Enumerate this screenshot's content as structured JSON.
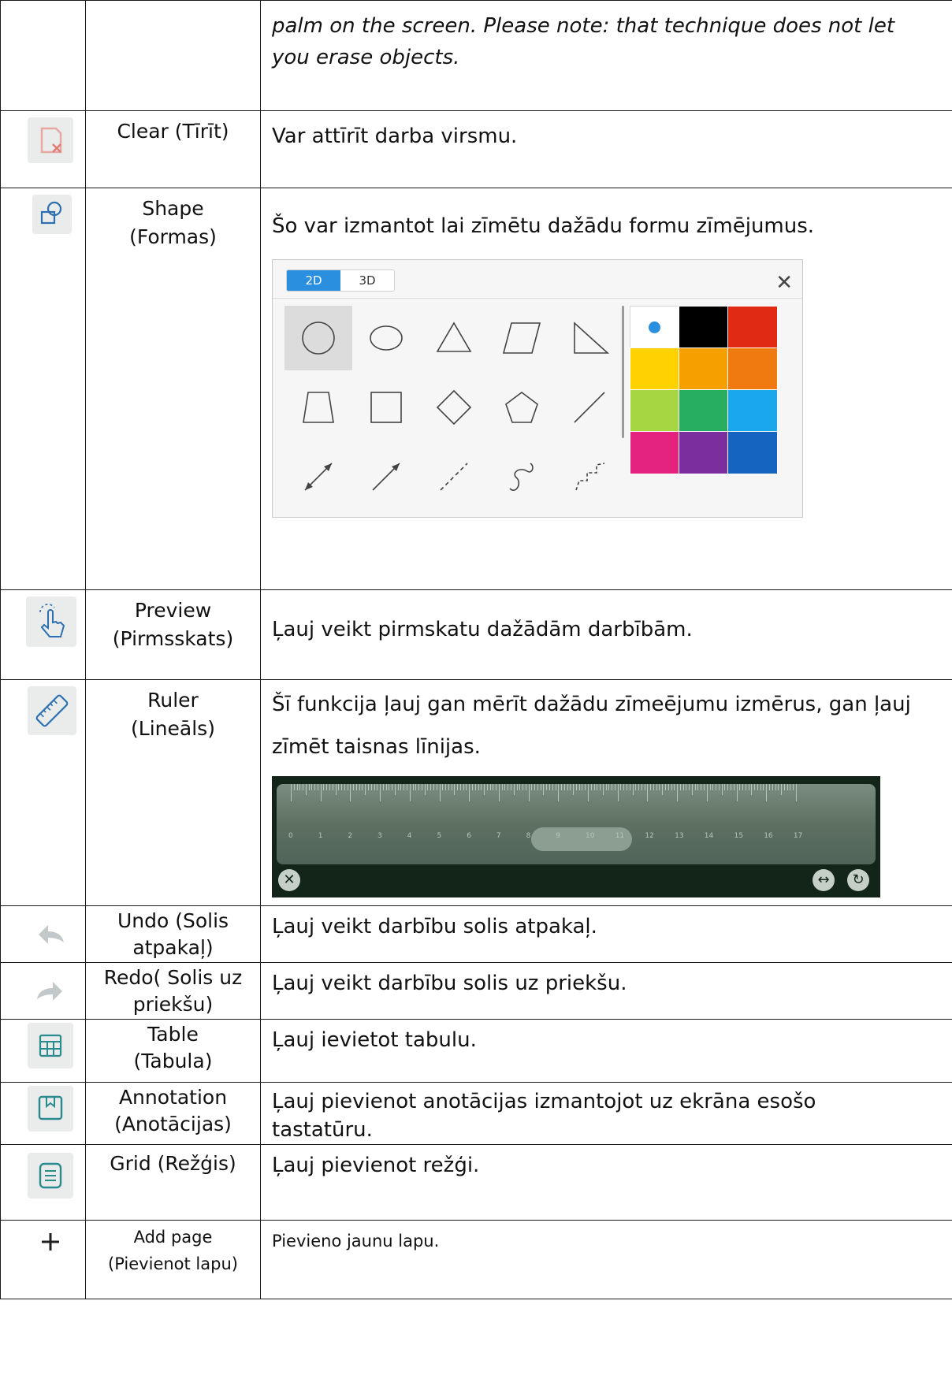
{
  "top_row": {
    "line1": "palm on the screen. Please note: that technique does not let",
    "line2": "you erase objects."
  },
  "rows": [
    {
      "name": "Clear (Tīrīt)",
      "desc": "Var attīrīt darba virsmu.",
      "icon": "clear-icon"
    },
    {
      "name": "Shape\n(Formas)",
      "desc": "Šo var izmantot lai zīmētu dažādu formu zīmējumus.",
      "icon": "shape-icon"
    },
    {
      "name": "Preview\n(Pirmsskats)",
      "desc": "Ļauj veikt pirmskatu dažādām darbībām.",
      "icon": "preview-hand-icon"
    },
    {
      "name": "Ruler\n(Lineāls)",
      "desc": "Šī funkcija ļauj gan mērīt dažādu zīmeējumu izmērus, gan ļauj\nzīmēt taisnas līnijas.",
      "icon": "ruler-icon"
    },
    {
      "name": "Undo (Solis\natpakaļ)",
      "desc": "Ļauj veikt darbību solis atpakaļ.",
      "icon": "undo-icon"
    },
    {
      "name": "Redo( Solis uz\npriekšu)",
      "desc": "Ļauj veikt darbību solis uz priekšu.",
      "icon": "redo-icon"
    },
    {
      "name": "Table\n(Tabula)",
      "desc": "Ļauj ievietot tabulu.",
      "icon": "table-icon"
    },
    {
      "name": "Annotation\n(Anotācijas)",
      "desc": "Ļauj pievienot anotācijas izmantojot uz ekrāna esošo\ntastatūru.",
      "icon": "annotation-icon"
    },
    {
      "name": "Grid (Režģis)",
      "desc": "Ļauj pievienot režģi.",
      "icon": "grid-icon"
    },
    {
      "name": "Add page\n(Pievienot lapu)",
      "desc": "Pievieno jaunu lapu.",
      "icon": "plus-icon"
    }
  ],
  "shape_panel": {
    "tabs": [
      "2D",
      "3D"
    ],
    "active_tab": "2D",
    "close": "✕",
    "shapes": [
      "circle",
      "ellipse",
      "triangle",
      "parallelogram",
      "right-triangle",
      "trapezoid",
      "square",
      "diamond",
      "pentagon",
      "line",
      "double-arrow",
      "arrow",
      "dashed-line",
      "curve",
      "dashed-curve"
    ],
    "selected_shape": "circle",
    "colors": [
      "#ffffff",
      "#000000",
      "#e02a14",
      "#ffd200",
      "#f5a000",
      "#ee7a10",
      "#a6d641",
      "#27ae60",
      "#1aa7ec",
      "#e4237f",
      "#7b2f9e",
      "#1565c0"
    ],
    "selected_color": "#ffffff"
  },
  "ruler": {
    "labels": [
      "0",
      "1",
      "2",
      "3",
      "4",
      "5",
      "6",
      "7",
      "8",
      "9",
      "10",
      "11",
      "12",
      "13",
      "14",
      "15",
      "16",
      "17"
    ],
    "close": "✕",
    "flip": "↔",
    "rotate": "↻"
  }
}
